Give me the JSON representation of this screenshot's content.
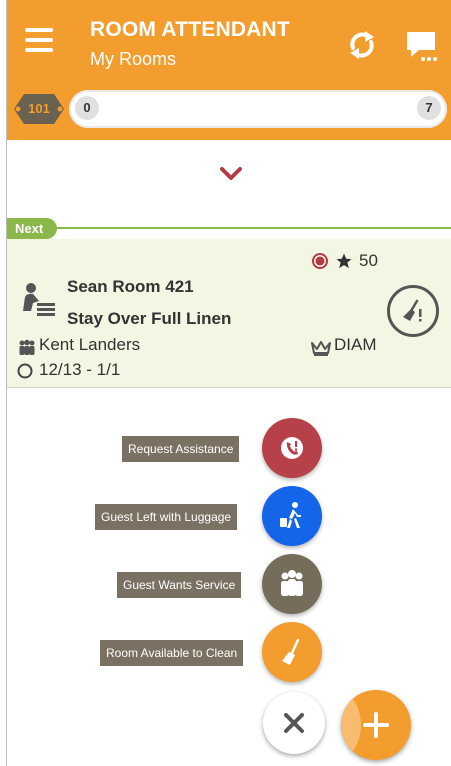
{
  "header": {
    "title": "ROOM ATTENDANT",
    "subtitle": "My Rooms",
    "icons": [
      "menu-icon",
      "sync-icon",
      "message-icon"
    ]
  },
  "progress": {
    "badge": "101",
    "start": "0",
    "end": "7"
  },
  "next_room": {
    "tag": "Next",
    "points": "50",
    "room": "Sean Room 421",
    "service": "Stay Over Full Linen",
    "guest": "Kent Landers",
    "vip": "DIAM",
    "dates": "12/13 - 1/1"
  },
  "fab_menu": [
    {
      "label": "Request Assistance",
      "icon": "phone-alert-icon",
      "color": "#b7414a"
    },
    {
      "label": "Guest Left with Luggage",
      "icon": "walking-luggage-icon",
      "color": "#1565e8"
    },
    {
      "label": "Guest Wants Service",
      "icon": "group-people-icon",
      "color": "#756c5c"
    },
    {
      "label": "Room Available to Clean",
      "icon": "broom-icon",
      "color": "#f29d2e"
    }
  ],
  "colors": {
    "accent": "#f29d2e",
    "next_green": "#8bb84a",
    "card_bg": "#f2f6e3",
    "chevron": "#b03a45"
  }
}
